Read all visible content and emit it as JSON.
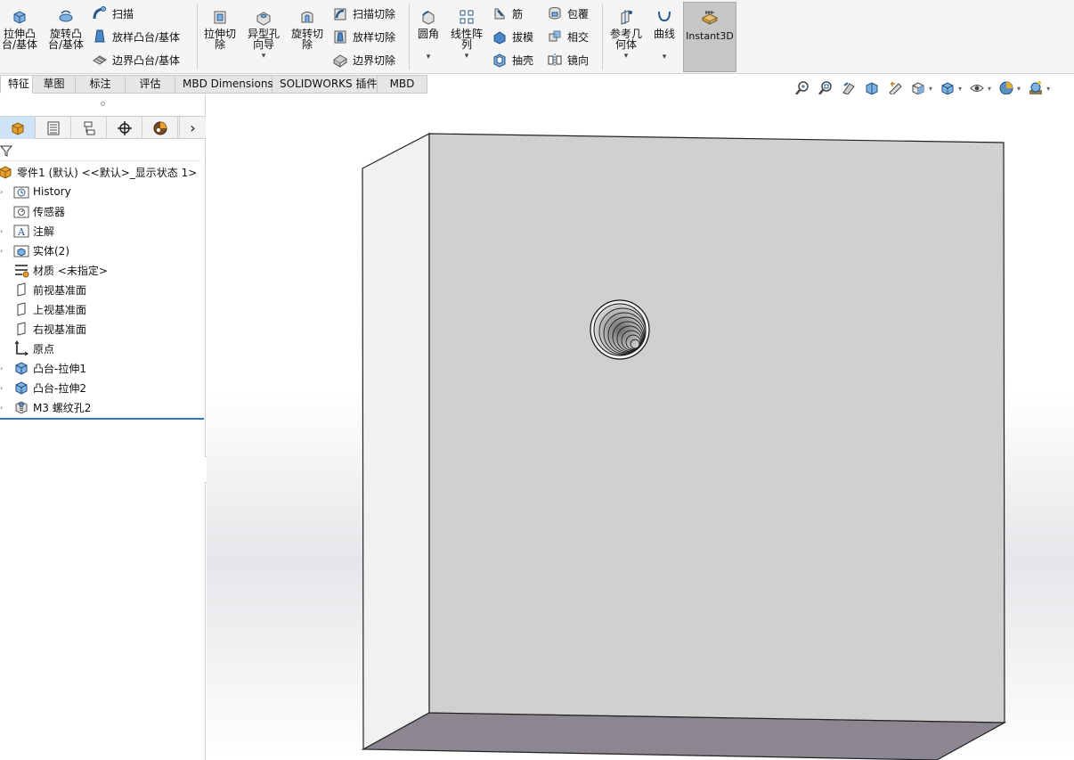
{
  "ribbon": {
    "extrude_boss": "拉伸凸\n台/基体",
    "revolve_boss": "旋转凸\n台/基体",
    "sweep": "扫描",
    "loft_boss": "放样凸台/基体",
    "boundary_boss": "边界凸台/基体",
    "extrude_cut": "拉伸切\n除",
    "hole_wizard": "异型孔\n向导",
    "revolve_cut": "旋转切\n除",
    "swept_cut": "扫描切除",
    "lofted_cut": "放样切除",
    "boundary_cut": "边界切除",
    "fillet": "圆角",
    "linear_pattern": "线性阵\n列",
    "rib": "筋",
    "draft": "拔模",
    "shell": "抽壳",
    "wrap": "包覆",
    "intersect": "相交",
    "mirror": "镜向",
    "ref_geometry": "参考几\n何体",
    "curves": "曲线",
    "instant3d": "Instant3D",
    "caret": "▾"
  },
  "tabs": [
    "特征",
    "草图",
    "标注",
    "评估",
    "MBD Dimensions",
    "SOLIDWORKS 插件",
    "MBD"
  ],
  "panel": {
    "more": "›"
  },
  "tree": {
    "root": "零件1 (默认) <<默认>_显示状态 1>",
    "items": {
      "history": "History",
      "sensors": "传感器",
      "annotations": "注解",
      "bodies": "实体(2)",
      "material": "材质 <未指定>",
      "front_plane": "前视基准面",
      "top_plane": "上视基准面",
      "right_plane": "右视基准面",
      "origin": "原点",
      "boss1": "凸台-拉伸1",
      "boss2": "凸台-拉伸2",
      "hole": "M3 螺纹孔2"
    }
  },
  "colors": {
    "accent": "#2f78c4",
    "instant3d_bg": "#c6c6c6",
    "front_face": "#d0d0d0",
    "side_face": "#f1f1f1",
    "bottom_face": "#8c8690"
  }
}
